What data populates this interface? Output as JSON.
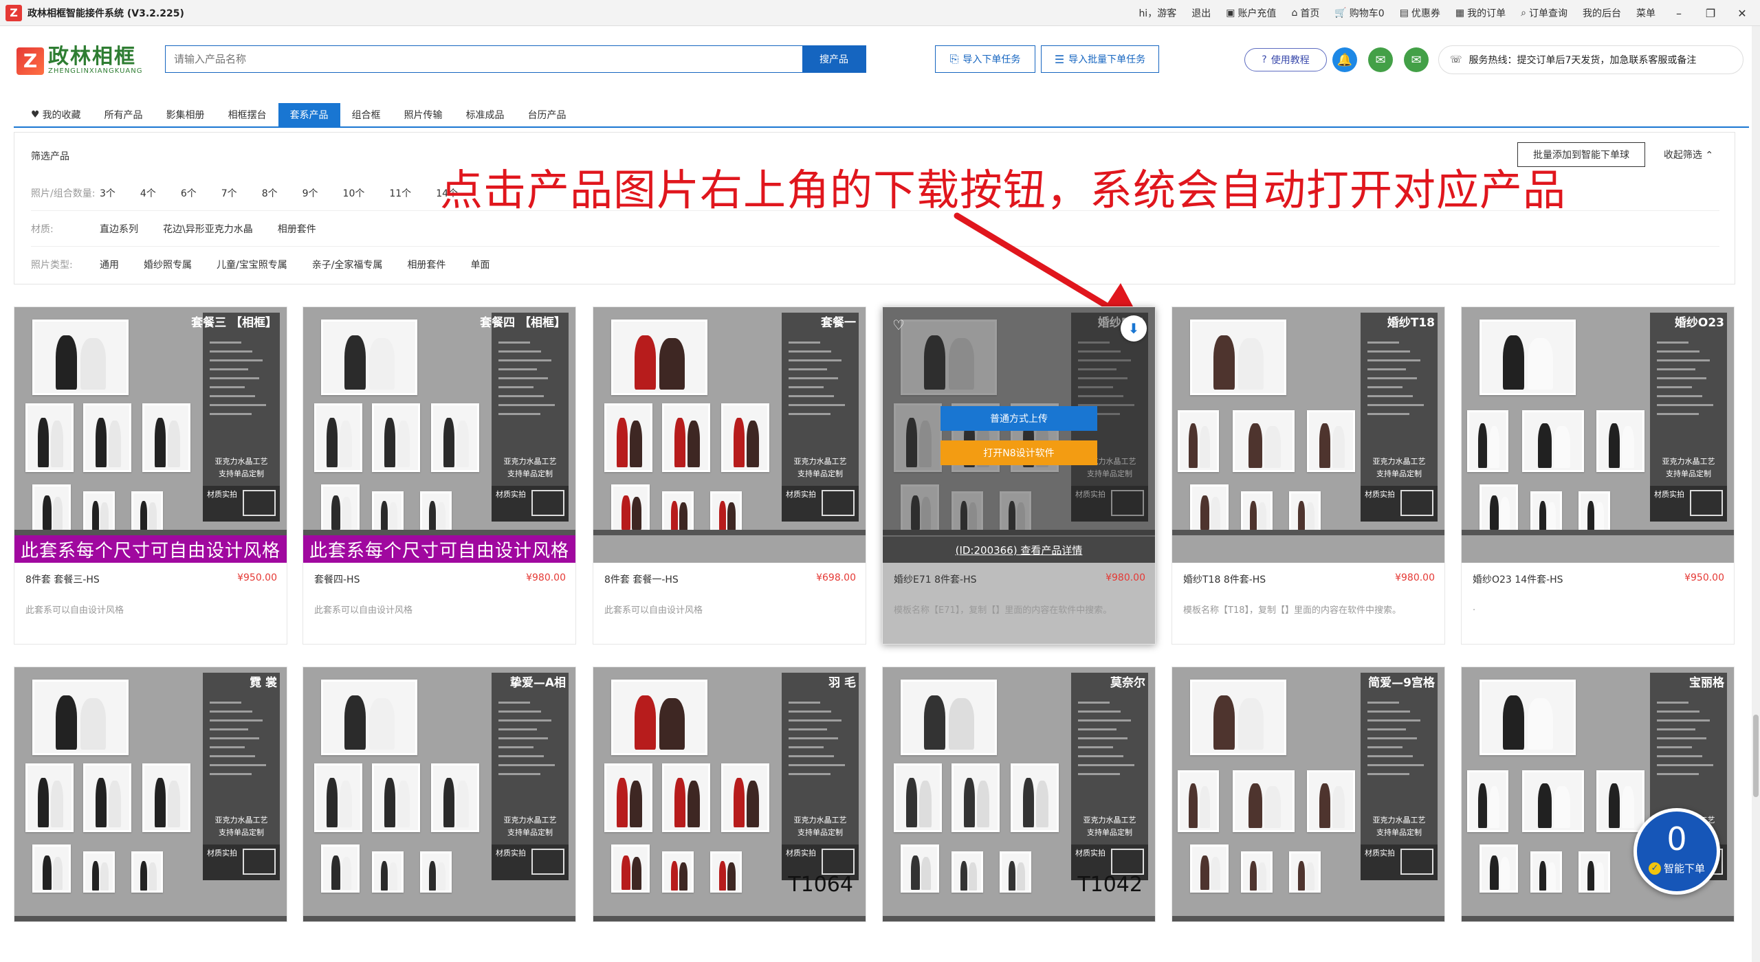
{
  "titlebar": {
    "app_title": "政林相框智能接件系统 (V3.2.225)",
    "greeting": "hi，游客",
    "logout": "退出",
    "recharge": "账户充值",
    "home": "首页",
    "cart": "购物车0",
    "coupons": "优惠券",
    "my_orders": "我的订单",
    "order_query": "订单查询",
    "my_backend": "我的后台",
    "menu": "菜单"
  },
  "header": {
    "logo_cn": "政林相框",
    "logo_en": "ZHENGLINXIANGKUANG",
    "search_placeholder": "请输入产品名称",
    "search_button": "搜产品",
    "import_order": "导入下单任务",
    "import_batch": "导入批量下单任务",
    "tutorial": "使用教程",
    "hotline": "服务热线：提交订单后7天发货，加急联系客服或备注"
  },
  "tabs": [
    {
      "label": "我的收藏",
      "active": false
    },
    {
      "label": "所有产品",
      "active": false
    },
    {
      "label": "影集相册",
      "active": false
    },
    {
      "label": "相框摆台",
      "active": false
    },
    {
      "label": "套系产品",
      "active": true
    },
    {
      "label": "组合框",
      "active": false
    },
    {
      "label": "照片传输",
      "active": false
    },
    {
      "label": "标准成品",
      "active": false
    },
    {
      "label": "台历产品",
      "active": false
    }
  ],
  "filter": {
    "title": "筛选产品",
    "batch_add": "批量添加到智能下单球",
    "collapse": "收起筛选 ⌃",
    "rows": [
      {
        "label": "照片/组合数量:",
        "options": [
          "3个",
          "4个",
          "6个",
          "7个",
          "8个",
          "9个",
          "10个",
          "11个",
          "14个"
        ]
      },
      {
        "label": "材质:",
        "options": [
          "直边系列",
          "花边\\异形亚克力水晶",
          "相册套件"
        ]
      },
      {
        "label": "照片类型:",
        "options": [
          "通用",
          "婚纱照专属",
          "儿童/宝宝照专属",
          "亲子/全家福专属",
          "相册套件",
          "单面"
        ]
      }
    ]
  },
  "annotation": "点击产品图片右上角的下载按钮，系统会自动打开对应产品",
  "products_row1": [
    {
      "title": "套餐三 【相框】",
      "name": "8件套 套餐三-HS",
      "price": "¥950.00",
      "desc": "此套系可以自由设计风格",
      "banner": "此套系每个尺寸可自由设计风格",
      "model": ""
    },
    {
      "title": "套餐四 【相框】",
      "name": "套餐四-HS",
      "price": "¥980.00",
      "desc": "此套系可以自由设计风格",
      "banner": "此套系每个尺寸可自由设计风格",
      "model": ""
    },
    {
      "title": "套餐一",
      "name": "8件套 套餐一-HS",
      "price": "¥698.00",
      "desc": "此套系可以自由设计风格",
      "banner": "",
      "model": ""
    },
    {
      "title": "婚纱E71",
      "name": "婚纱E71 8件套-HS",
      "price": "¥980.00",
      "desc": "模板名称【E71】，复制【】里面的内容在软件中搜索。",
      "banner": "",
      "model": ""
    },
    {
      "title": "婚纱T18",
      "name": "婚纱T18 8件套-HS",
      "price": "¥980.00",
      "desc": "模板名称【T18】，复制【】里面的内容在软件中搜索。",
      "banner": "",
      "model": ""
    },
    {
      "title": "婚纱O23",
      "name": "婚纱O23 14件套-HS",
      "price": "¥950.00",
      "desc": ".",
      "banner": "",
      "model": ""
    }
  ],
  "products_row2": [
    {
      "title": "霓 裳",
      "model": ""
    },
    {
      "title": "挚爱—A相",
      "model": ""
    },
    {
      "title": "羽 毛",
      "model": "T1064"
    },
    {
      "title": "莫奈尔",
      "model": "T1042"
    },
    {
      "title": "简爱—9宫格",
      "model": ""
    },
    {
      "title": "宝丽格",
      "model": ""
    }
  ],
  "hover": {
    "upload": "普通方式上传",
    "open_n8": "打开N8设计软件",
    "detail": "(ID:200366) 查看产品详情"
  },
  "spec_notes": {
    "craft": "亚克力水晶工艺",
    "custom": "支持单品定制",
    "material": "材质实拍"
  },
  "smart_order": {
    "count": "0",
    "label": "智能下单"
  },
  "colors": {
    "accent": "#1976d2",
    "price": "#e53935",
    "annotation": "#e0161d",
    "banner": "#a0089f"
  }
}
